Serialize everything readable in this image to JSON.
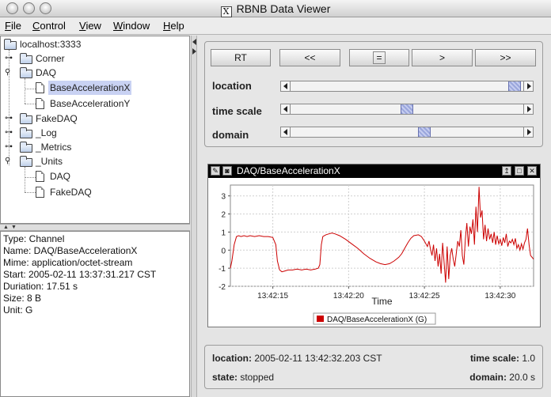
{
  "window": {
    "title": "RBNB Data Viewer"
  },
  "menu": {
    "items": [
      {
        "first": "F",
        "rest": "ile"
      },
      {
        "first": "C",
        "rest": "ontrol"
      },
      {
        "first": "V",
        "rest": "iew"
      },
      {
        "first": "W",
        "rest": "indow"
      },
      {
        "first": "H",
        "rest": "elp"
      }
    ]
  },
  "tree": {
    "root": "localhost:3333",
    "corner": "Corner",
    "daq": "DAQ",
    "bax": "BaseAccelerationX",
    "bay": "BaseAccelerationY",
    "fakedaq": "FakeDAQ",
    "log": "_Log",
    "metrics": "_Metrics",
    "units": "_Units",
    "u_daq": "DAQ",
    "u_fakedaq": "FakeDAQ"
  },
  "info": {
    "type": "Type: Channel",
    "name": "Name: DAQ/BaseAccelerationX",
    "mime": "Mime: application/octet-stream",
    "start": "Start: 2005-02-11 13:37:31.217 CST",
    "duration": "Duriation: 17.51 s",
    "size": "Size: 8 B",
    "unit": "Unit: G"
  },
  "controls": {
    "buttons": [
      "RT",
      "<<",
      "=",
      ">",
      ">>"
    ],
    "location_label": "location",
    "timescale_label": "time scale",
    "domain_label": "domain",
    "location_pos": 0.99,
    "timescale_pos": 0.5,
    "domain_pos": 0.58
  },
  "plot": {
    "title": "DAQ/BaseAccelerationX",
    "legend": "DAQ/BaseAccelerationX (G)"
  },
  "chart_data": {
    "type": "line",
    "xlabel": "Time",
    "ylabel": "",
    "xtick_labels": [
      "13:42:15",
      "13:42:20",
      "13:42:25",
      "13:42:30"
    ],
    "xtick_values": [
      15,
      20,
      25,
      30
    ],
    "xlim": [
      12.2,
      32.2
    ],
    "ylim": [
      -2,
      3.6
    ],
    "yticks": [
      -2,
      -1,
      0,
      1,
      2,
      3
    ],
    "grid": true,
    "legend_position": "bottom",
    "color": "#cc0000",
    "series": [
      {
        "name": "DAQ/BaseAccelerationX (G)",
        "x": [
          12.2,
          12.3,
          12.45,
          12.6,
          12.75,
          12.9,
          13.1,
          13.3,
          13.5,
          13.8,
          14.1,
          14.4,
          14.7,
          15.0,
          15.2,
          15.3,
          15.45,
          15.6,
          15.8,
          16.0,
          16.3,
          16.6,
          16.9,
          17.2,
          17.5,
          17.8,
          18.0,
          18.1,
          18.2,
          18.3,
          18.5,
          18.7,
          18.9,
          19.1,
          19.4,
          19.8,
          20.2,
          20.6,
          21.0,
          21.4,
          21.8,
          22.1,
          22.4,
          22.7,
          23.0,
          23.3,
          23.5,
          23.7,
          23.9,
          24.1,
          24.3,
          24.6,
          24.8,
          25.0,
          25.2,
          25.3,
          25.4,
          25.5,
          25.6,
          25.7,
          25.8,
          25.9,
          26.0,
          26.1,
          26.2,
          26.3,
          26.4,
          26.5,
          26.6,
          26.7,
          26.8,
          26.9,
          27.0,
          27.1,
          27.2,
          27.3,
          27.4,
          27.5,
          27.6,
          27.7,
          27.8,
          27.9,
          28.0,
          28.1,
          28.2,
          28.3,
          28.4,
          28.5,
          28.6,
          28.7,
          28.8,
          28.9,
          29.0,
          29.1,
          29.2,
          29.3,
          29.4,
          29.5,
          29.6,
          29.7,
          29.8,
          29.9,
          30.0,
          30.1,
          30.2,
          30.3,
          30.4,
          30.5,
          30.6,
          30.7,
          30.8,
          30.9,
          31.0,
          31.1,
          31.2,
          31.3,
          31.4,
          31.5,
          31.6,
          31.7,
          31.8,
          31.9,
          32.0,
          32.2
        ],
        "y": [
          -1.0,
          -0.6,
          0.3,
          0.75,
          0.8,
          0.75,
          0.8,
          0.75,
          0.8,
          0.75,
          0.8,
          0.75,
          0.75,
          0.7,
          0.3,
          -0.6,
          -1.1,
          -1.2,
          -1.15,
          -1.1,
          -1.1,
          -1.05,
          -1.1,
          -1.05,
          -1.1,
          -1.05,
          -1.0,
          -0.8,
          0.3,
          0.75,
          0.85,
          0.9,
          0.95,
          0.9,
          0.8,
          0.6,
          0.35,
          0.1,
          -0.2,
          -0.45,
          -0.65,
          -0.75,
          -0.8,
          -0.75,
          -0.6,
          -0.4,
          -0.2,
          0.1,
          0.4,
          0.65,
          0.8,
          0.85,
          0.75,
          0.5,
          0.2,
          0.5,
          0.05,
          -0.3,
          0.3,
          -0.6,
          0.1,
          -0.9,
          -0.2,
          -1.3,
          0.4,
          -0.7,
          -1.8,
          0.2,
          -1.6,
          -0.3,
          0.1,
          -0.5,
          -0.9,
          -0.2,
          0.5,
          0.2,
          1.1,
          -0.3,
          -0.8,
          0.6,
          1.5,
          0.2,
          1.3,
          0.9,
          1.7,
          0.3,
          2.4,
          1.0,
          3.5,
          1.8,
          2.2,
          0.6,
          1.4,
          0.5,
          1.2,
          0.6,
          0.9,
          0.4,
          1.0,
          0.3,
          0.8,
          0.35,
          0.6,
          0.25,
          0.7,
          0.4,
          0.9,
          0.2,
          0.5,
          0.4,
          0.6,
          0.3,
          0.65,
          0.1,
          0.3,
          0.0,
          0.35,
          0.05,
          0.4,
          0.6,
          1.2,
          0.3,
          -0.3,
          -0.5
        ]
      }
    ]
  }
}
